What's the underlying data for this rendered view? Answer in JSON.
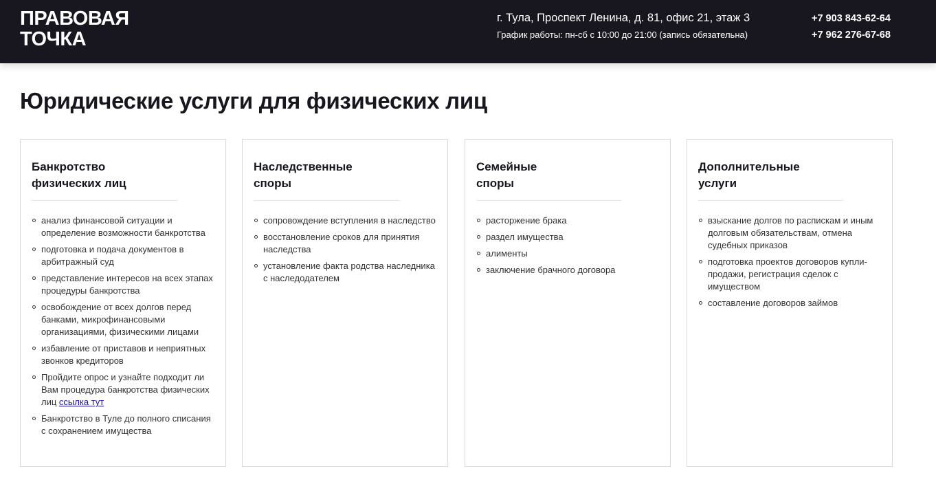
{
  "header": {
    "logo_line1": "ПРАВОВАЯ",
    "logo_line2": "ТОЧКА",
    "address": "г. Тула, Проспект Ленина, д. 81, офис 21, этаж 3",
    "schedule": "График работы: пн-сб с 10:00 до 21:00 (запись обязательна)",
    "phone1": "+7 903 843-62-64",
    "phone2": "+7 962 276-67-68",
    "background_color": "#18171f"
  },
  "main": {
    "title": "Юридические услуги для физических лиц"
  },
  "cards": [
    {
      "title_line1": "Банкротство",
      "title_line2": "физических лиц",
      "items": [
        "анализ финансовой ситуации и определение возможности банкротства",
        "подготовка и подача документов в арбитражный суд",
        "представление интересов на всех этапах процедуры банкротства",
        "освобождение от всех долгов перед банками, микрофинансовыми организациями, физическими лицами",
        "избавление от приставов и неприятных звонков кредиторов",
        "Пройдите опрос и узнайте подходит ли Вам процедура банкротства физических лиц",
        "Банкротство в Туле до полного списания с сохранением имущества"
      ],
      "link_text": "ссылка тут"
    },
    {
      "title_line1": "Наследственные",
      "title_line2": "споры",
      "items": [
        "сопровождение вступления в наследство",
        "восстановление сроков для принятия наследства",
        "установление факта родства наследника с наследодателем"
      ]
    },
    {
      "title_line1": "Семейные",
      "title_line2": "споры",
      "items": [
        "расторжение брака",
        "раздел имущества",
        "алименты",
        "заключение брачного договора"
      ]
    },
    {
      "title_line1": "Дополнительные",
      "title_line2": "услуги",
      "items": [
        "взыскание долгов по распискам и иным долговым обязательствам, отмена судебных приказов",
        "подготовка проектов договоров купли-продажи, регистрация сделок с имуществом",
        "составление договоров займов"
      ]
    }
  ]
}
